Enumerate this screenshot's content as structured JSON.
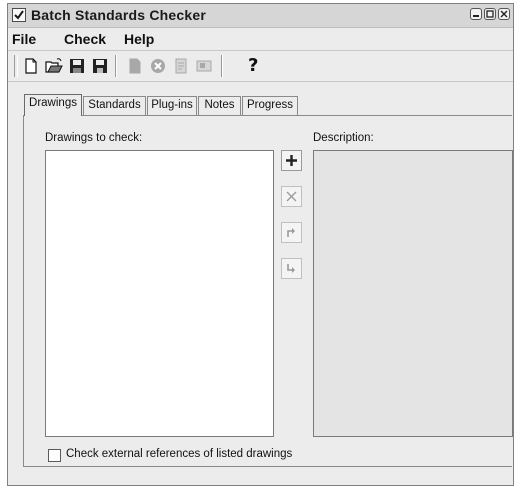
{
  "window": {
    "title": "Batch Standards Checker",
    "app_icon": "checkmark-app-icon",
    "controls": [
      "minimize-icon",
      "maximize-icon",
      "close-icon"
    ]
  },
  "menu": {
    "items": [
      {
        "label": "File"
      },
      {
        "label": "Check"
      },
      {
        "label": "Help"
      }
    ]
  },
  "toolbar": {
    "buttons": [
      {
        "icon": "new-document-icon",
        "enabled": true
      },
      {
        "icon": "open-folder-icon",
        "enabled": true
      },
      {
        "icon": "save-icon",
        "enabled": true
      },
      {
        "icon": "save-as-icon",
        "enabled": true
      },
      {
        "icon": "check-document-icon",
        "enabled": false
      },
      {
        "icon": "stop-icon",
        "enabled": false
      },
      {
        "icon": "report-icon",
        "enabled": false
      },
      {
        "icon": "export-report-icon",
        "enabled": false
      }
    ],
    "help_label": "?"
  },
  "tabs": [
    {
      "label": "Drawings",
      "active": true
    },
    {
      "label": "Standards",
      "active": false
    },
    {
      "label": "Plug-ins",
      "active": false
    },
    {
      "label": "Notes",
      "active": false
    },
    {
      "label": "Progress",
      "active": false
    }
  ],
  "drawings_panel": {
    "list_label": "Drawings to check:",
    "description_label": "Description:",
    "side_buttons": [
      {
        "icon": "add-icon",
        "enabled": true
      },
      {
        "icon": "remove-icon",
        "enabled": false
      },
      {
        "icon": "move-up-icon",
        "enabled": false
      },
      {
        "icon": "move-down-icon",
        "enabled": false
      }
    ],
    "xref_checkbox_label": "Check external references of listed drawings",
    "xref_checkbox_checked": false
  },
  "colors": {
    "window_bg": "#ececec",
    "list_bg": "#ffffff",
    "description_bg": "#e4e4e4",
    "disabled_icon": "#a8a8a8"
  }
}
